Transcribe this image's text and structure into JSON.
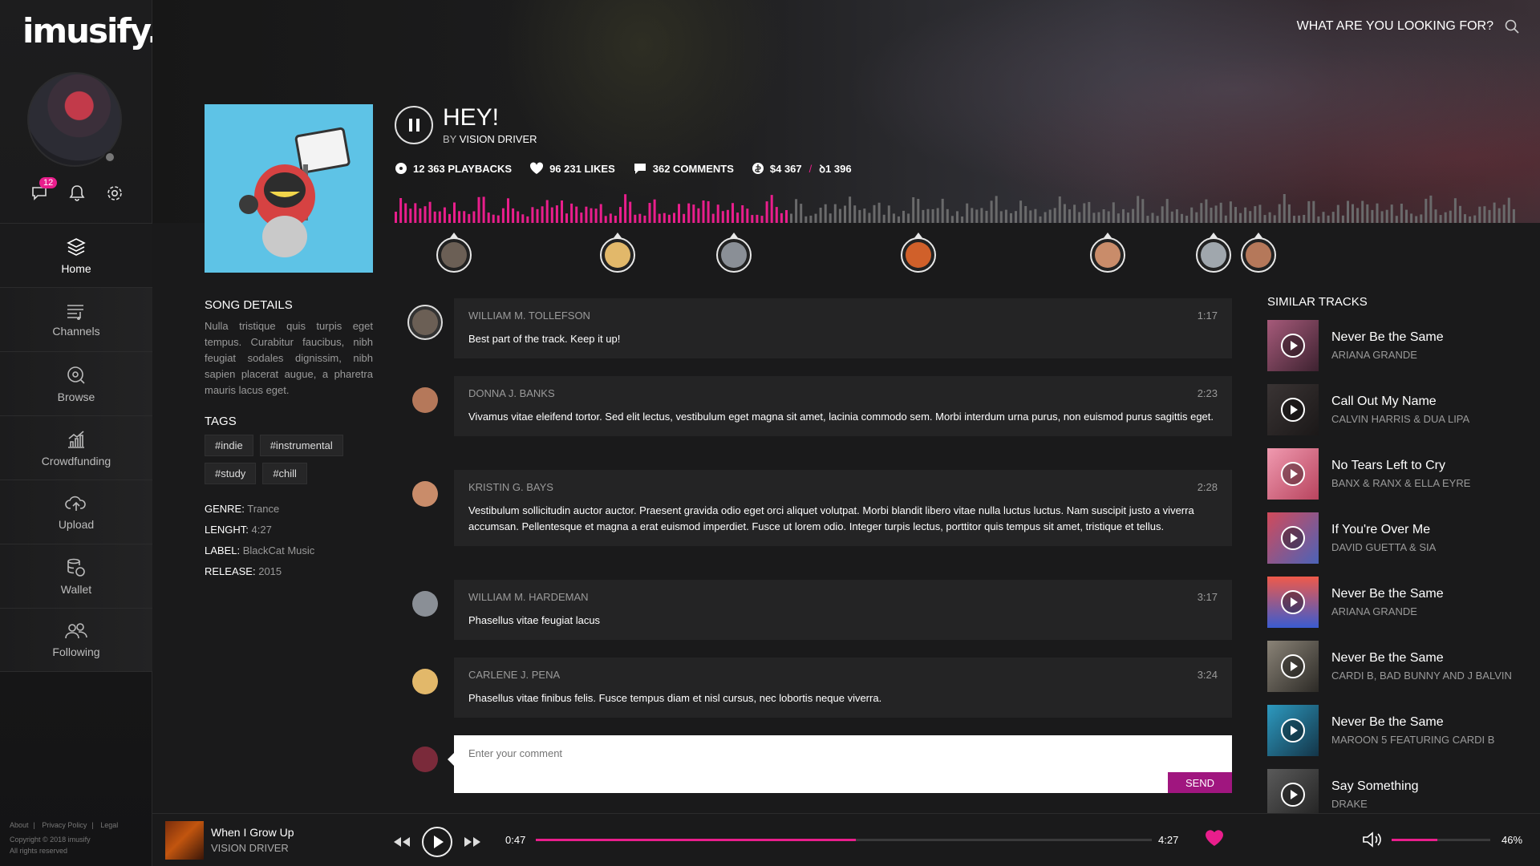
{
  "app": {
    "logo": "imusify."
  },
  "sidebar": {
    "messages_badge": "12",
    "nav": [
      {
        "label": "Home",
        "icon": "layers-icon"
      },
      {
        "label": "Channels",
        "icon": "channels-icon"
      },
      {
        "label": "Browse",
        "icon": "browse-icon"
      },
      {
        "label": "Crowdfunding",
        "icon": "chart-icon"
      },
      {
        "label": "Upload",
        "icon": "upload-icon"
      },
      {
        "label": "Wallet",
        "icon": "wallet-icon"
      },
      {
        "label": "Following",
        "icon": "following-icon"
      }
    ],
    "footer": {
      "about": "About",
      "privacy": "Privacy Policy",
      "legal": "Legal",
      "copyright": "Copyright © 2018 imusify",
      "rights": "All rights reserved"
    }
  },
  "search": {
    "label": "WHAT ARE YOU LOOKING FOR?"
  },
  "song": {
    "title": "HEY!",
    "by_prefix": "BY",
    "artist": "VISION DRIVER",
    "stats": {
      "playbacks": "12 363 PLAYBACKS",
      "likes": "96 231 LIKES",
      "comments": "362 COMMENTS",
      "funds": "$4 367",
      "funds_sep": "/",
      "funds_target": "ꝺ1 396"
    },
    "waveform_played_fraction": 0.35
  },
  "details": {
    "heading": "SONG DETAILS",
    "description": "Nulla tristique quis turpis eget tempus. Curabitur faucibus, nibh feugiat sodales dignissim, nibh sapien placerat augue, a pharetra mauris lacus eget.",
    "tags_heading": "TAGS",
    "tags": [
      "#indie",
      "#instrumental",
      "#study",
      "#chill"
    ],
    "genre_label": "GENRE:",
    "genre": "Trance",
    "length_label": "LENGHT:",
    "length": "4:27",
    "label_label": "LABEL:",
    "label": "BlackCat Music",
    "release_label": "RELEASE:",
    "release": "2015"
  },
  "comments": [
    {
      "name": "WILLIAM M. TOLLEFSON",
      "time": "1:17",
      "text": "Best part of the track. Keep it up!",
      "color": "#6b5f55"
    },
    {
      "name": "DONNA J. BANKS",
      "time": "2:23",
      "text": "Vivamus vitae eleifend tortor. Sed elit lectus, vestibulum eget magna sit amet, lacinia commodo sem. Morbi interdum urna purus, non euismod purus sagittis eget.",
      "color": "#b5785a"
    },
    {
      "name": "KRISTIN G. BAYS",
      "time": "2:28",
      "text": "Vestibulum sollicitudin auctor auctor. Praesent gravida odio eget orci aliquet volutpat. Morbi blandit libero vitae nulla luctus luctus. Nam suscipit justo a viverra accumsan. Pellentesque et magna a erat euismod imperdiet. Fusce ut lorem odio. Integer turpis lectus, porttitor quis tempus sit amet, tristique et tellus.",
      "color": "#c98c6a"
    },
    {
      "name": "WILLIAM M. HARDEMAN",
      "time": "3:17",
      "text": "Phasellus vitae feugiat lacus",
      "color": "#8a8f96"
    },
    {
      "name": "CARLENE J. PENA",
      "time": "3:24",
      "text": "Phasellus vitae finibus felis. Fusce tempus diam et nisl cursus, nec lobortis neque viverra.",
      "color": "#e2b86a"
    }
  ],
  "comment_input": {
    "placeholder": "Enter your comment",
    "send": "SEND"
  },
  "similar": {
    "heading": "SIMILAR TRACKS",
    "tracks": [
      {
        "title": "Never Be the Same",
        "artist": "ARIANA GRANDE",
        "color": "#a65a7a"
      },
      {
        "title": "Call Out My Name",
        "artist": "CALVIN HARRIS & DUA LIPA",
        "color": "#3a3434"
      },
      {
        "title": "No Tears Left to Cry",
        "artist": "BANX & RANX & ELLA EYRE",
        "color": "#d2738a"
      },
      {
        "title": "If You're Over Me",
        "artist": "DAVID GUETTA & SIA",
        "color": "#c4344e"
      },
      {
        "title": "Never Be the Same",
        "artist": "ARIANA GRANDE",
        "color": "#e44a52"
      },
      {
        "title": "Never Be the Same",
        "artist": "CARDI B, BAD BUNNY AND J BALVIN",
        "color": "#5f5a52"
      },
      {
        "title": "Never Be the Same",
        "artist": "MAROON 5 FEATURING CARDI B",
        "color": "#1f6f8f"
      },
      {
        "title": "Say Something",
        "artist": "DRAKE",
        "color": "#4a4a4a"
      }
    ]
  },
  "player": {
    "title": "When I Grow Up",
    "artist": "VISION DRIVER",
    "elapsed": "0:47",
    "total": "4:27",
    "progress_fraction": 0.52,
    "volume": "46%",
    "volume_fraction": 0.46,
    "accent": "#e91e8c"
  }
}
